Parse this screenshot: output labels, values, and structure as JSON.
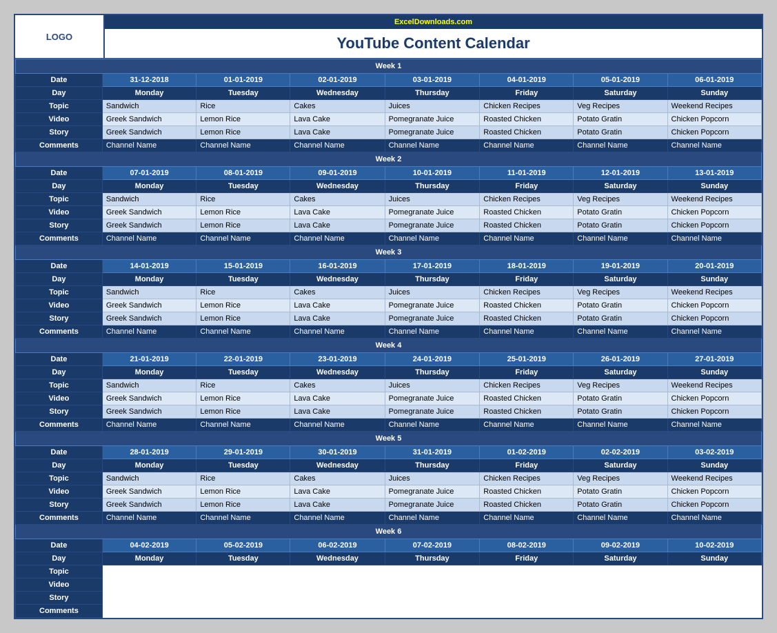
{
  "branding": {
    "logo": "LOGO",
    "excel_url": "ExcelDownloads.com",
    "title": "YouTube Content Calendar"
  },
  "weeks": [
    {
      "label": "Week  1",
      "dates": [
        "31-12-2018",
        "01-01-2019",
        "02-01-2019",
        "03-01-2019",
        "04-01-2019",
        "05-01-2019",
        "06-01-2019"
      ],
      "days": [
        "Monday",
        "Tuesday",
        "Wednesday",
        "Thursday",
        "Friday",
        "Saturday",
        "Sunday"
      ],
      "topic": [
        "Sandwich",
        "Rice",
        "Cakes",
        "Juices",
        "Chicken Recipes",
        "Veg Recipes",
        "Weekend Recipes"
      ],
      "video": [
        "Greek Sandwich",
        "Lemon Rice",
        "Lava Cake",
        "Pomegranate Juice",
        "Roasted Chicken",
        "Potato Gratin",
        "Chicken Popcorn"
      ],
      "story": [
        "Greek Sandwich",
        "Lemon Rice",
        "Lava Cake",
        "Pomegranate Juice",
        "Roasted Chicken",
        "Potato Gratin",
        "Chicken Popcorn"
      ],
      "comments": [
        "Channel Name",
        "Channel Name",
        "Channel Name",
        "Channel Name",
        "Channel Name",
        "Channel Name",
        "Channel Name"
      ]
    },
    {
      "label": "Week  2",
      "dates": [
        "07-01-2019",
        "08-01-2019",
        "09-01-2019",
        "10-01-2019",
        "11-01-2019",
        "12-01-2019",
        "13-01-2019"
      ],
      "days": [
        "Monday",
        "Tuesday",
        "Wednesday",
        "Thursday",
        "Friday",
        "Saturday",
        "Sunday"
      ],
      "topic": [
        "Sandwich",
        "Rice",
        "Cakes",
        "Juices",
        "Chicken Recipes",
        "Veg Recipes",
        "Weekend Recipes"
      ],
      "video": [
        "Greek Sandwich",
        "Lemon Rice",
        "Lava Cake",
        "Pomegranate Juice",
        "Roasted Chicken",
        "Potato Gratin",
        "Chicken Popcorn"
      ],
      "story": [
        "Greek Sandwich",
        "Lemon Rice",
        "Lava Cake",
        "Pomegranate Juice",
        "Roasted Chicken",
        "Potato Gratin",
        "Chicken Popcorn"
      ],
      "comments": [
        "Channel Name",
        "Channel Name",
        "Channel Name",
        "Channel Name",
        "Channel Name",
        "Channel Name",
        "Channel Name"
      ]
    },
    {
      "label": "Week  3",
      "dates": [
        "14-01-2019",
        "15-01-2019",
        "16-01-2019",
        "17-01-2019",
        "18-01-2019",
        "19-01-2019",
        "20-01-2019"
      ],
      "days": [
        "Monday",
        "Tuesday",
        "Wednesday",
        "Thursday",
        "Friday",
        "Saturday",
        "Sunday"
      ],
      "topic": [
        "Sandwich",
        "Rice",
        "Cakes",
        "Juices",
        "Chicken Recipes",
        "Veg Recipes",
        "Weekend Recipes"
      ],
      "video": [
        "Greek Sandwich",
        "Lemon Rice",
        "Lava Cake",
        "Pomegranate Juice",
        "Roasted Chicken",
        "Potato Gratin",
        "Chicken Popcorn"
      ],
      "story": [
        "Greek Sandwich",
        "Lemon Rice",
        "Lava Cake",
        "Pomegranate Juice",
        "Roasted Chicken",
        "Potato Gratin",
        "Chicken Popcorn"
      ],
      "comments": [
        "Channel Name",
        "Channel Name",
        "Channel Name",
        "Channel Name",
        "Channel Name",
        "Channel Name",
        "Channel Name"
      ]
    },
    {
      "label": "Week  4",
      "dates": [
        "21-01-2019",
        "22-01-2019",
        "23-01-2019",
        "24-01-2019",
        "25-01-2019",
        "26-01-2019",
        "27-01-2019"
      ],
      "days": [
        "Monday",
        "Tuesday",
        "Wednesday",
        "Thursday",
        "Friday",
        "Saturday",
        "Sunday"
      ],
      "topic": [
        "Sandwich",
        "Rice",
        "Cakes",
        "Juices",
        "Chicken Recipes",
        "Veg Recipes",
        "Weekend Recipes"
      ],
      "video": [
        "Greek Sandwich",
        "Lemon Rice",
        "Lava Cake",
        "Pomegranate Juice",
        "Roasted Chicken",
        "Potato Gratin",
        "Chicken Popcorn"
      ],
      "story": [
        "Greek Sandwich",
        "Lemon Rice",
        "Lava Cake",
        "Pomegranate Juice",
        "Roasted Chicken",
        "Potato Gratin",
        "Chicken Popcorn"
      ],
      "comments": [
        "Channel Name",
        "Channel Name",
        "Channel Name",
        "Channel Name",
        "Channel Name",
        "Channel Name",
        "Channel Name"
      ]
    },
    {
      "label": "Week  5",
      "dates": [
        "28-01-2019",
        "29-01-2019",
        "30-01-2019",
        "31-01-2019",
        "01-02-2019",
        "02-02-2019",
        "03-02-2019"
      ],
      "days": [
        "Monday",
        "Tuesday",
        "Wednesday",
        "Thursday",
        "Friday",
        "Saturday",
        "Sunday"
      ],
      "topic": [
        "Sandwich",
        "Rice",
        "Cakes",
        "Juices",
        "Chicken Recipes",
        "Veg Recipes",
        "Weekend Recipes"
      ],
      "video": [
        "Greek Sandwich",
        "Lemon Rice",
        "Lava Cake",
        "Pomegranate Juice",
        "Roasted Chicken",
        "Potato Gratin",
        "Chicken Popcorn"
      ],
      "story": [
        "Greek Sandwich",
        "Lemon Rice",
        "Lava Cake",
        "Pomegranate Juice",
        "Roasted Chicken",
        "Potato Gratin",
        "Chicken Popcorn"
      ],
      "comments": [
        "Channel Name",
        "Channel Name",
        "Channel Name",
        "Channel Name",
        "Channel Name",
        "Channel Name",
        "Channel Name"
      ]
    },
    {
      "label": "Week  6",
      "dates": [
        "04-02-2019",
        "05-02-2019",
        "06-02-2019",
        "07-02-2019",
        "08-02-2019",
        "09-02-2019",
        "10-02-2019"
      ],
      "days": [
        "Monday",
        "Tuesday",
        "Wednesday",
        "Thursday",
        "Friday",
        "Saturday",
        "Sunday"
      ],
      "topic": [],
      "video": [],
      "story": [],
      "comments": []
    }
  ],
  "row_labels": {
    "date": "Date",
    "day": "Day",
    "topic": "Topic",
    "video": "Video",
    "story": "Story",
    "comments": "Comments"
  }
}
